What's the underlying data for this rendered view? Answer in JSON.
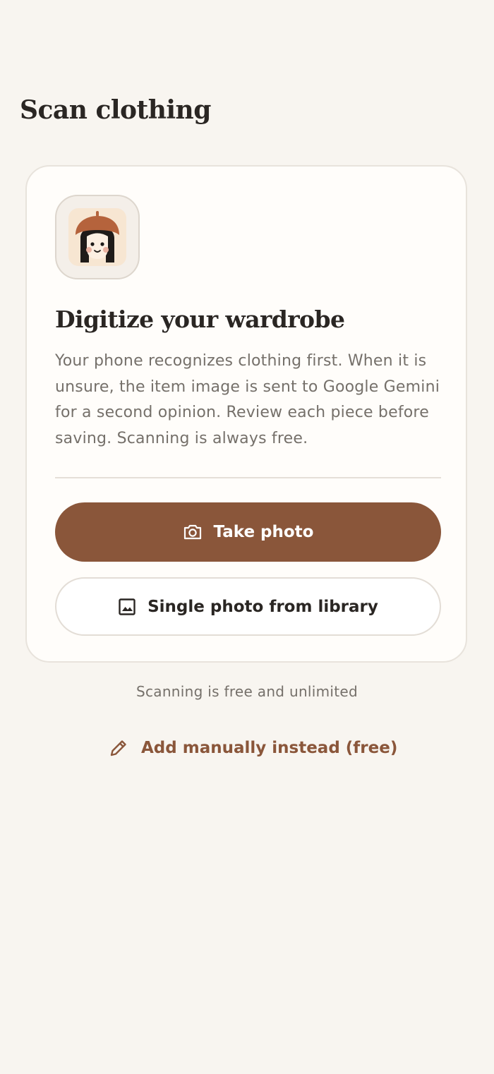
{
  "header": {
    "title": "Scan clothing"
  },
  "card": {
    "app_icon": "beret-avatar-icon",
    "heading": "Digitize your wardrobe",
    "description": "Your phone recognizes clothing first. When it is unsure, the item image is sent to Google Gemini for a second opinion. Review each piece before saving. Scanning is always free.",
    "take_photo": {
      "label": "Take photo",
      "icon": "camera-icon"
    },
    "library": {
      "label": "Single photo from library",
      "icon": "image-icon"
    }
  },
  "footnote": "Scanning is free and unlimited",
  "manual": {
    "label": "Add manually instead (free)",
    "icon": "pencil-icon"
  },
  "colors": {
    "background": "#f8f5f0",
    "accent": "#8a563a",
    "card": "#fffdfa",
    "text": "#2a2623",
    "muted_text": "#75706a"
  }
}
